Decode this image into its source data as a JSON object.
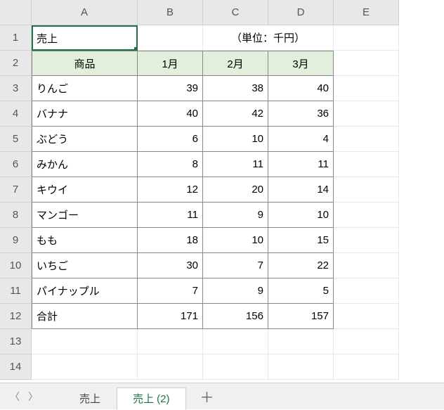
{
  "columns": [
    "A",
    "B",
    "C",
    "D",
    "E"
  ],
  "rowCount": 14,
  "title": "売上",
  "unit": "（単位：千円）",
  "tableHeader": {
    "product": "商品",
    "months": [
      "1月",
      "2月",
      "3月"
    ]
  },
  "rows": [
    {
      "name": "りんご",
      "vals": [
        39,
        38,
        40
      ]
    },
    {
      "name": "バナナ",
      "vals": [
        40,
        42,
        36
      ]
    },
    {
      "name": "ぶどう",
      "vals": [
        6,
        10,
        4
      ]
    },
    {
      "name": "みかん",
      "vals": [
        8,
        11,
        11
      ]
    },
    {
      "name": "キウイ",
      "vals": [
        12,
        20,
        14
      ]
    },
    {
      "name": "マンゴー",
      "vals": [
        11,
        9,
        10
      ]
    },
    {
      "name": "もも",
      "vals": [
        18,
        10,
        15
      ]
    },
    {
      "name": "いちご",
      "vals": [
        30,
        7,
        22
      ]
    },
    {
      "name": "パイナップル",
      "vals": [
        7,
        9,
        5
      ]
    }
  ],
  "total": {
    "label": "合計",
    "vals": [
      171,
      156,
      157
    ]
  },
  "tabs": [
    {
      "label": "売上",
      "active": false
    },
    {
      "label": "売上 (2)",
      "active": true
    }
  ],
  "addLabel": "＋",
  "navPrev": "〈",
  "navNext": "〉"
}
